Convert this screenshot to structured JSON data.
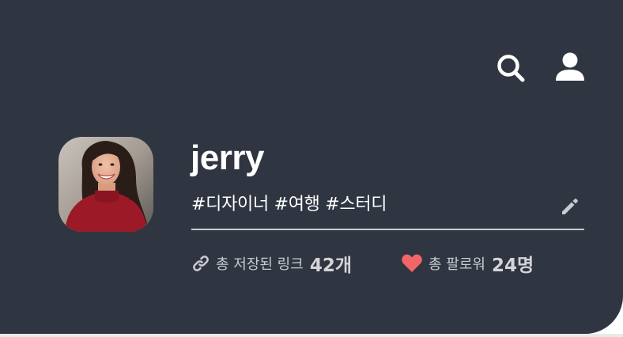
{
  "header": {
    "search_icon": "search-icon",
    "user_icon": "user-icon"
  },
  "profile": {
    "avatar_icon": "avatar-photo",
    "username": "jerry",
    "tags": "#디자이너 #여행 #스터디",
    "edit_icon": "pencil-icon"
  },
  "stats": {
    "links": {
      "icon": "link-icon",
      "label": "총 저장된 링크",
      "count": "42개"
    },
    "followers": {
      "icon": "heart-icon",
      "label": "총 팔로워",
      "count": "24명"
    }
  },
  "colors": {
    "background": "#2f3541",
    "text": "#ffffff",
    "muted_text": "#c9cbd0",
    "heart": "#f16667",
    "avatar_sweater": "#9c1a27"
  }
}
